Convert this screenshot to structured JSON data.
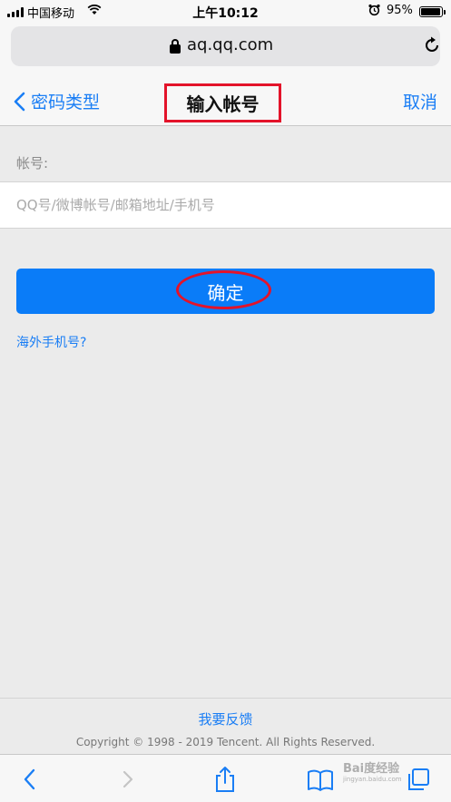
{
  "status_bar": {
    "carrier": "中国移动",
    "time": "上午10:12",
    "battery": "95%"
  },
  "browser": {
    "url": "aq.qq.com"
  },
  "nav": {
    "back_label": "密码类型",
    "title": "输入帐号",
    "cancel_label": "取消"
  },
  "form": {
    "account_label": "帐号:",
    "account_value": "",
    "account_placeholder": "QQ号/微博帐号/邮箱地址/手机号",
    "confirm_label": "确定",
    "overseas_link": "海外手机号?"
  },
  "footer": {
    "feedback": "我要反馈",
    "copyright": "Copyright © 1998 - 2019 Tencent. All Rights Reserved."
  },
  "toolbar": {
    "icons": [
      "back-icon",
      "forward-icon",
      "share-icon",
      "bookmarks-icon",
      "tabs-icon"
    ]
  },
  "watermark": {
    "text": "Bai度经验",
    "sub": "jingyan.baidu.com"
  },
  "colors": {
    "accent": "#1a7ef5",
    "button": "#0a7cf8",
    "highlight": "#e3132a",
    "background": "#ebebeb"
  }
}
